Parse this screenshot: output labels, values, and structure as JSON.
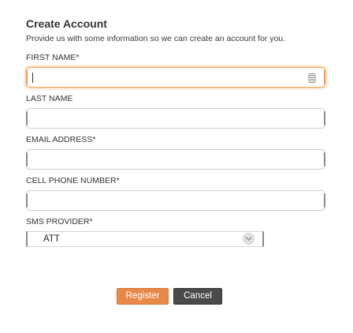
{
  "form": {
    "title": "Create Account",
    "subtitle": "Provide us with some information so we can create an account for you.",
    "fields": [
      {
        "label": "FIRST NAME*",
        "value": "",
        "focused": true
      },
      {
        "label": "LAST NAME",
        "value": ""
      },
      {
        "label": "EMAIL ADDRESS*",
        "value": ""
      },
      {
        "label": "CELL PHONE NUMBER*",
        "value": ""
      }
    ],
    "sms_provider": {
      "label": "SMS PROVIDER*",
      "selected": "ATT"
    },
    "buttons": {
      "register": "Register",
      "cancel": "Cancel"
    }
  },
  "colors": {
    "accent": "#e8894a",
    "focus_border": "#f4a35a",
    "dark_button": "#4a4a4a",
    "text": "#333333"
  },
  "icons": {
    "autofill": "autofill-icon",
    "dropdown": "chevron-down-icon"
  }
}
